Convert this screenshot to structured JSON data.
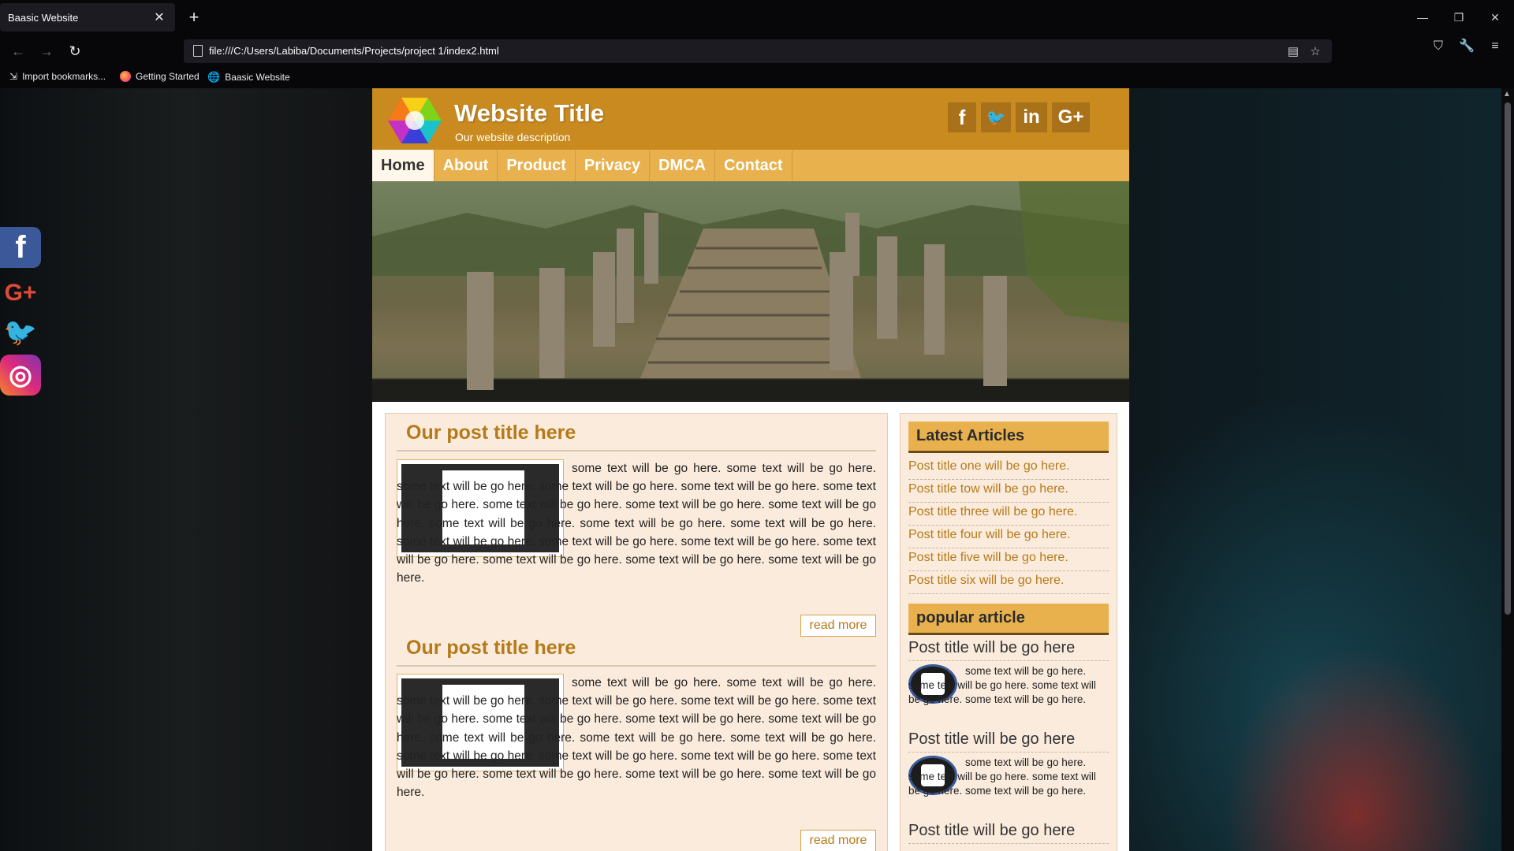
{
  "browser": {
    "tab_title": "Baasic Website",
    "tab_close": "✕",
    "new_tab": "+",
    "url": "file:///C:/Users/Labiba/Documents/Projects/project 1/index2.html",
    "bookmarks": [
      {
        "label": "Import bookmarks...",
        "icon": "import-icon"
      },
      {
        "label": "Getting Started",
        "icon": "firefox-icon"
      },
      {
        "label": "Baasic Website",
        "icon": "globe-icon"
      }
    ]
  },
  "side_social": [
    {
      "name": "facebook",
      "glyph": "f",
      "color": "#3b5998"
    },
    {
      "name": "google-plus",
      "glyph": "G+",
      "color": "#dd4b39"
    },
    {
      "name": "twitter",
      "glyph": "🐦",
      "color": "#1da1f2"
    },
    {
      "name": "instagram",
      "glyph": "◎",
      "color": "#c13584"
    }
  ],
  "site": {
    "title": "Website Title",
    "description": "Our website description",
    "social": [
      "f",
      "🐦",
      "in",
      "G+"
    ],
    "menu": [
      "Home",
      "About",
      "Product",
      "Privacy",
      "DMCA",
      "Contact"
    ],
    "posts": [
      {
        "title": "Our post title here",
        "text": "some text will be go here. some text will be go here. some text will be go here. some text will be go here. some text will be go here. some text will be go here. some text will be go here. some text will be go here. some text will be go here. some text will be go here. some text will be go here. some text will be go here. some text will be go here. some text will be go here. some text will be go here. some text will be go here. some text will be go here. some text will be go here. some text will be go here.",
        "read_more": "read more"
      },
      {
        "title": "Our post title here",
        "text": "some text will be go here. some text will be go here. some text will be go here. some text will be go here. some text will be go here. some text will be go here. some text will be go here. some text will be go here. some text will be go here. some text will be go here. some text will be go here. some text will be go here. some text will be go here. some text will be go here. some text will be go here. some text will be go here. some text will be go here. some text will be go here. some text will be go here.",
        "read_more": "read more"
      }
    ],
    "sidebar": {
      "latest_heading": "Latest Articles",
      "latest": [
        "Post title one will be go here.",
        "Post title tow will be go here.",
        "Post title three will be go here.",
        "Post title four will be go here.",
        "Post title five will be go here.",
        "Post title six will be go here."
      ],
      "popular_heading": "popular article",
      "popular": [
        {
          "title": "Post title will be go here",
          "text": "some text will be go here. some text will be go here. some text will be go here. some text will be go here."
        },
        {
          "title": "Post title will be go here",
          "text": "some text will be go here. some text will be go here. some text will be go here. some text will be go here."
        },
        {
          "title": "Post title will be go here",
          "text": ""
        }
      ]
    }
  },
  "colors": {
    "header": "#c98a1f",
    "menu": "#e8b14e",
    "accent_text": "#b57a18",
    "panel_bg": "#fbebdc"
  }
}
